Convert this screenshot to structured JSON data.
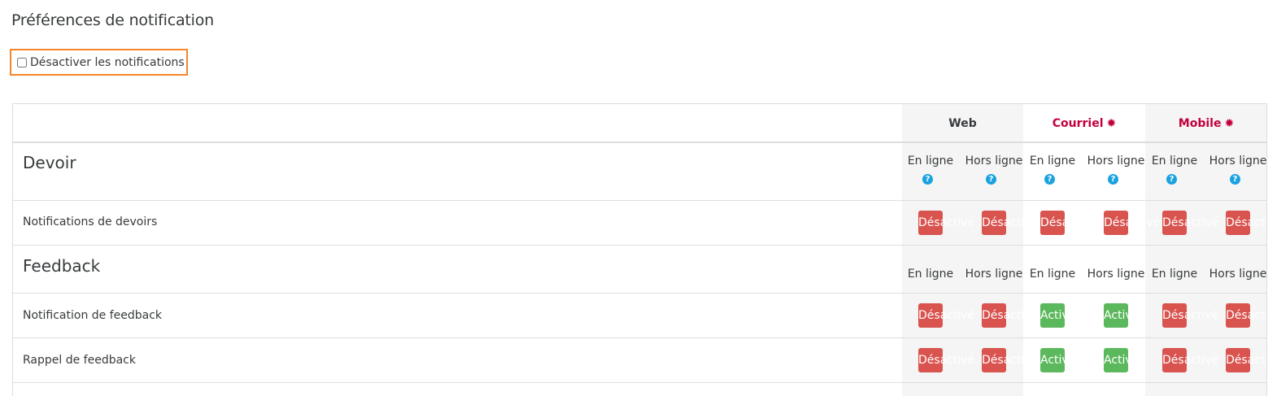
{
  "page": {
    "title": "Préférences de notification"
  },
  "disable": {
    "label": "Désactiver les notifications",
    "checked": false
  },
  "processors": [
    {
      "name": "Web",
      "has_config": false
    },
    {
      "name": "Courriel",
      "has_config": true,
      "config_icon": "gear-icon"
    },
    {
      "name": "Mobile",
      "has_config": true,
      "config_icon": "gear-icon"
    }
  ],
  "states": {
    "online": "En ligne",
    "offline": "Hors ligne",
    "help_icon": "question-circle-icon"
  },
  "toggle_text": {
    "off": "Désactivé",
    "on": "Activé"
  },
  "colors": {
    "off": "#d9534f",
    "on": "#5cb85c",
    "link": "#c4003b",
    "help": "#1aa2e0",
    "highlight": "#f7862a"
  },
  "sections": [
    {
      "title": "Devoir",
      "rows": [
        {
          "label": "Notifications de devoirs",
          "states": [
            "off",
            "off",
            "off",
            "off",
            "off",
            "off"
          ]
        }
      ]
    },
    {
      "title": "Feedback",
      "rows": [
        {
          "label": "Notification de feedback",
          "states": [
            "off",
            "off",
            "on",
            "on",
            "off",
            "off"
          ]
        },
        {
          "label": "Rappel de feedback",
          "states": [
            "off",
            "off",
            "on",
            "on",
            "off",
            "off"
          ]
        }
      ]
    }
  ]
}
